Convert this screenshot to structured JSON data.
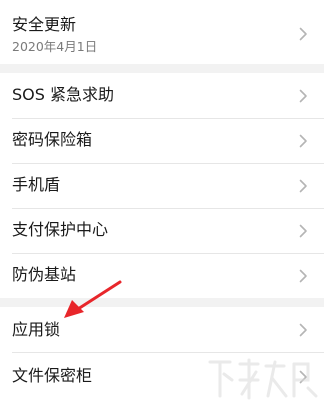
{
  "settings": {
    "groups": [
      {
        "items": [
          {
            "title": "安全更新",
            "subtitle": "2020年4月1日"
          }
        ]
      },
      {
        "items": [
          {
            "title": "SOS 紧急求助"
          },
          {
            "title": "密码保险箱"
          },
          {
            "title": "手机盾"
          },
          {
            "title": "支付保护中心"
          },
          {
            "title": "防伪基站"
          }
        ]
      },
      {
        "items": [
          {
            "title": "应用锁"
          },
          {
            "title": "文件保密柜"
          }
        ]
      }
    ]
  },
  "annotation": {
    "arrow_color": "#e8262b"
  },
  "watermark": {
    "icon": "xiazaiba-watermark-logo"
  },
  "colors": {
    "background": "#f2f2f2",
    "card": "#ffffff",
    "chevron": "#b5b5b5",
    "subtitle": "#7a7a7a"
  }
}
